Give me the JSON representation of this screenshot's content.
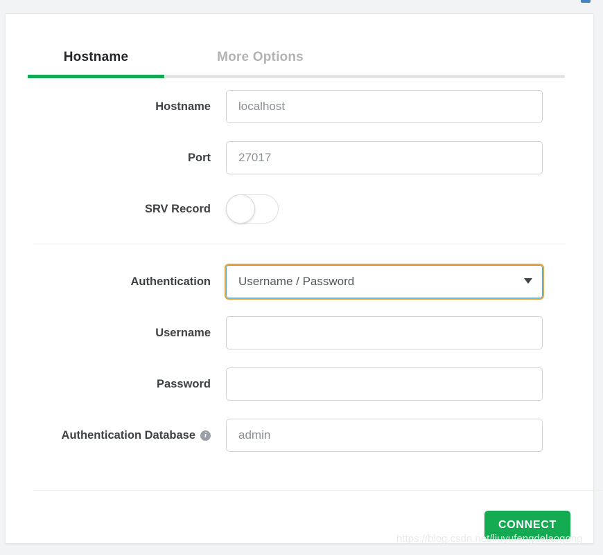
{
  "tabs": [
    {
      "label": "Hostname",
      "active": true
    },
    {
      "label": "More Options",
      "active": false
    }
  ],
  "form": {
    "hostname": {
      "label": "Hostname",
      "value": "",
      "placeholder": "localhost"
    },
    "port": {
      "label": "Port",
      "value": "",
      "placeholder": "27017"
    },
    "srv_record": {
      "label": "SRV Record",
      "state": "off"
    },
    "authentication": {
      "label": "Authentication",
      "selected": "Username / Password",
      "caret": "chevron-down-icon",
      "focused": true
    },
    "username": {
      "label": "Username",
      "value": "",
      "placeholder": ""
    },
    "password": {
      "label": "Password",
      "value": "",
      "placeholder": ""
    },
    "auth_database": {
      "label": "Authentication Database",
      "info_icon": "info-icon",
      "value": "",
      "placeholder": "admin"
    }
  },
  "footer": {
    "connect_label": "CONNECT"
  },
  "watermark": {
    "text": "https://blog.csdn.net/liuyufengdelaogong"
  },
  "colors": {
    "accent_green": "#13aa52",
    "page_background": "#f2f3f5",
    "card_background": "#ffffff",
    "label_text": "#3d4144",
    "placeholder_text": "#8a8f94",
    "inactive_tab": "#b3b3b3",
    "focus_ring": "#e8a33d",
    "focus_border": "#5aa9d6"
  }
}
